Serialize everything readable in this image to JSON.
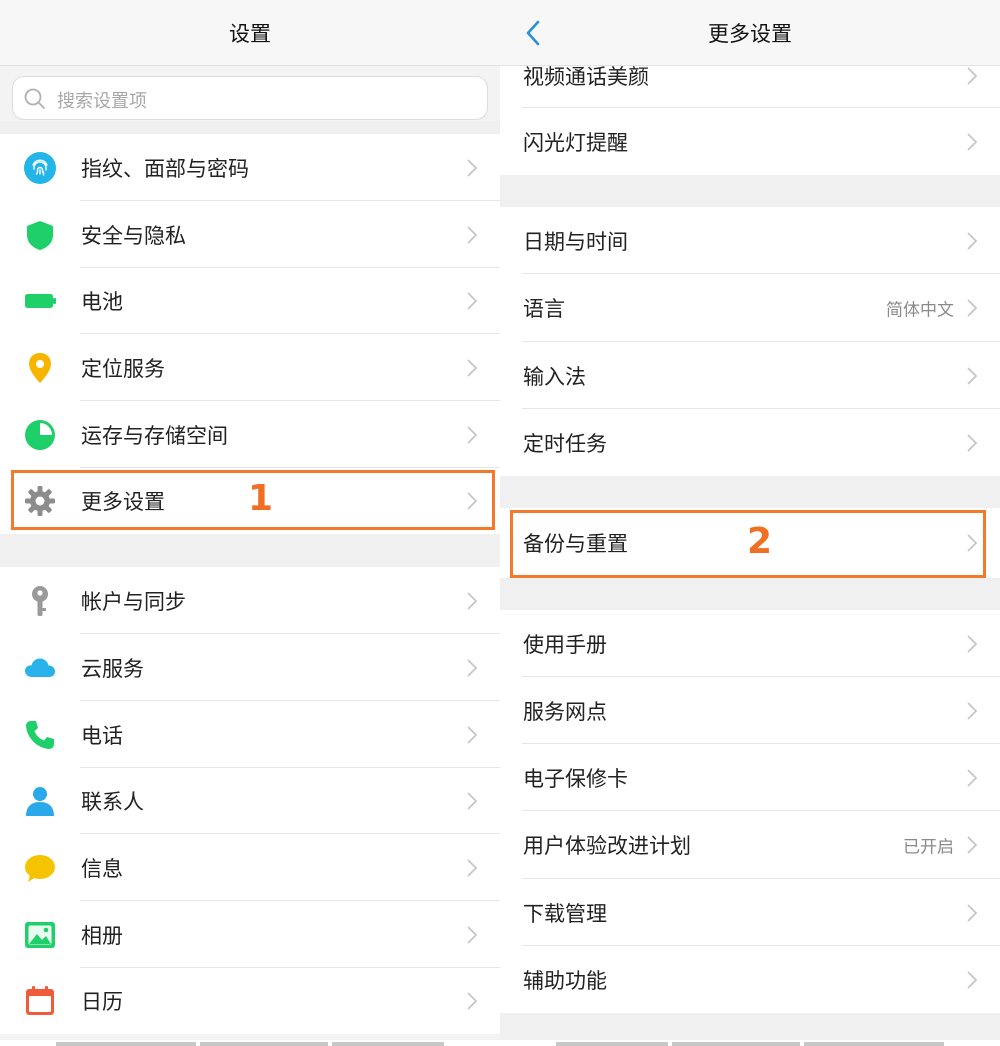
{
  "left": {
    "title": "设置",
    "search_placeholder": "搜索设置项",
    "items": [
      {
        "label": "指纹、面部与密码",
        "icon": "fingerprint-icon"
      },
      {
        "label": "安全与隐私",
        "icon": "shield-icon"
      },
      {
        "label": "电池",
        "icon": "battery-icon"
      },
      {
        "label": "定位服务",
        "icon": "location-pin-icon"
      },
      {
        "label": "运存与存储空间",
        "icon": "pie-chart-icon"
      },
      {
        "label": "更多设置",
        "icon": "gear-icon"
      },
      {
        "label": "帐户与同步",
        "icon": "key-icon"
      },
      {
        "label": "云服务",
        "icon": "cloud-icon"
      },
      {
        "label": "电话",
        "icon": "phone-icon"
      },
      {
        "label": "联系人",
        "icon": "contact-icon"
      },
      {
        "label": "信息",
        "icon": "message-icon"
      },
      {
        "label": "相册",
        "icon": "gallery-icon"
      },
      {
        "label": "日历",
        "icon": "calendar-icon"
      }
    ],
    "annotation": "1"
  },
  "right": {
    "title": "更多设置",
    "items": [
      {
        "label": "视频通话美颜",
        "value": ""
      },
      {
        "label": "闪光灯提醒",
        "value": ""
      },
      {
        "label": "日期与时间",
        "value": ""
      },
      {
        "label": "语言",
        "value": "简体中文"
      },
      {
        "label": "输入法",
        "value": ""
      },
      {
        "label": "定时任务",
        "value": ""
      },
      {
        "label": "备份与重置",
        "value": ""
      },
      {
        "label": "使用手册",
        "value": ""
      },
      {
        "label": "服务网点",
        "value": ""
      },
      {
        "label": "电子保修卡",
        "value": ""
      },
      {
        "label": "用户体验改进计划",
        "value": "已开启"
      },
      {
        "label": "下载管理",
        "value": ""
      },
      {
        "label": "辅助功能",
        "value": ""
      }
    ],
    "annotation": "2"
  },
  "colors": {
    "highlight": "#f37a2c",
    "accent_blue": "#2b8fd6",
    "accent_green": "#1fcf6a"
  }
}
